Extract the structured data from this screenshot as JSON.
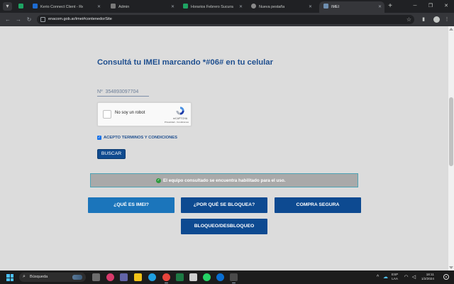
{
  "browser": {
    "tabs": [
      {
        "title": "",
        "favicon_color": "#1ea362",
        "active": false
      },
      {
        "title": "Kerio Connect Client - Re: I",
        "favicon_color": "#1d6bd1",
        "active": false
      },
      {
        "title": "Admin",
        "favicon_color": "#7a7a7a",
        "active": false
      },
      {
        "title": "Horarios Febrero Sucursales",
        "favicon_color": "#1ea362",
        "active": false
      },
      {
        "title": "Nueva pestaña",
        "favicon_color": "#8a8a8a",
        "active": false
      },
      {
        "title": "IMEI",
        "favicon_color": "#6f8fb0",
        "active": true
      }
    ],
    "url": "enacom.gob.ar/imei#contenedorSite",
    "colors": {
      "tabstrip": "#202124",
      "toolbar": "#35363a"
    }
  },
  "page": {
    "heading": "Consultá tu IMEI marcando *#06# en tu celular",
    "imei_value": "Nº  354893097704",
    "recaptcha": {
      "label": "No soy un robot",
      "brand": "reCAPTCHA",
      "links": "Privacidad - Condiciones"
    },
    "terms_label": "ACEPTO TERMINOS Y CONDICIONES",
    "search_button": "BUSCAR",
    "result_message": "El equipo consultado se encuentra habilitado para el uso.",
    "nav_buttons": {
      "what_is_imei": "¿QUÉ ES IMEI?",
      "why_blocked": "¿POR QUÉ SE BLOQUEA?",
      "safe_purchase": "COMPRA SEGURA",
      "block_unblock": "BLOQUEO/DESBLOQUEO"
    },
    "colors": {
      "heading": "#1f4f8f",
      "primary_button": "#0d4a91",
      "secondary_button": "#1b75bb",
      "success_icon": "#2e9a3e"
    }
  },
  "taskbar": {
    "search_placeholder": "Búsqueda",
    "language_top": "ESP",
    "language_bottom": "LAA",
    "time": "18:11",
    "date": "1/2/2024"
  }
}
